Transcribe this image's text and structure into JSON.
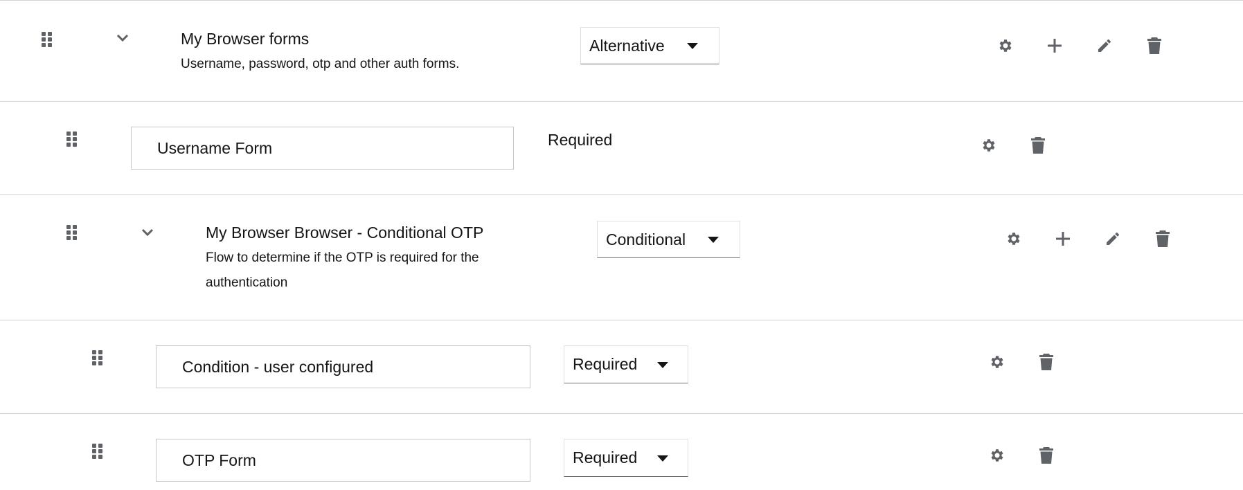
{
  "rows": [
    {
      "title": "My Browser forms",
      "description": "Username, password, otp and other auth forms.",
      "requirement": "Alternative",
      "icons": [
        "drag-handle-icon",
        "chevron-down-icon",
        "gear-icon",
        "plus-icon",
        "pencil-icon",
        "trash-icon"
      ]
    },
    {
      "name": "Username Form",
      "requirement": "Required",
      "icons": [
        "drag-handle-icon",
        "gear-icon",
        "trash-icon"
      ]
    },
    {
      "title": "My Browser Browser - Conditional OTP",
      "description_line1": "Flow to determine if the OTP is required for the",
      "description_line2": "authentication",
      "requirement": "Conditional",
      "icons": [
        "drag-handle-icon",
        "chevron-down-icon",
        "gear-icon",
        "plus-icon",
        "pencil-icon",
        "trash-icon"
      ]
    },
    {
      "name": "Condition - user configured",
      "requirement": "Required",
      "icons": [
        "drag-handle-icon",
        "gear-icon",
        "trash-icon"
      ]
    },
    {
      "name": "OTP Form",
      "requirement": "Required",
      "icons": [
        "drag-handle-icon",
        "gear-icon",
        "trash-icon"
      ]
    }
  ],
  "colors": {
    "icon": "#5f6266",
    "border": "#d2d2d2",
    "text": "#151515"
  }
}
